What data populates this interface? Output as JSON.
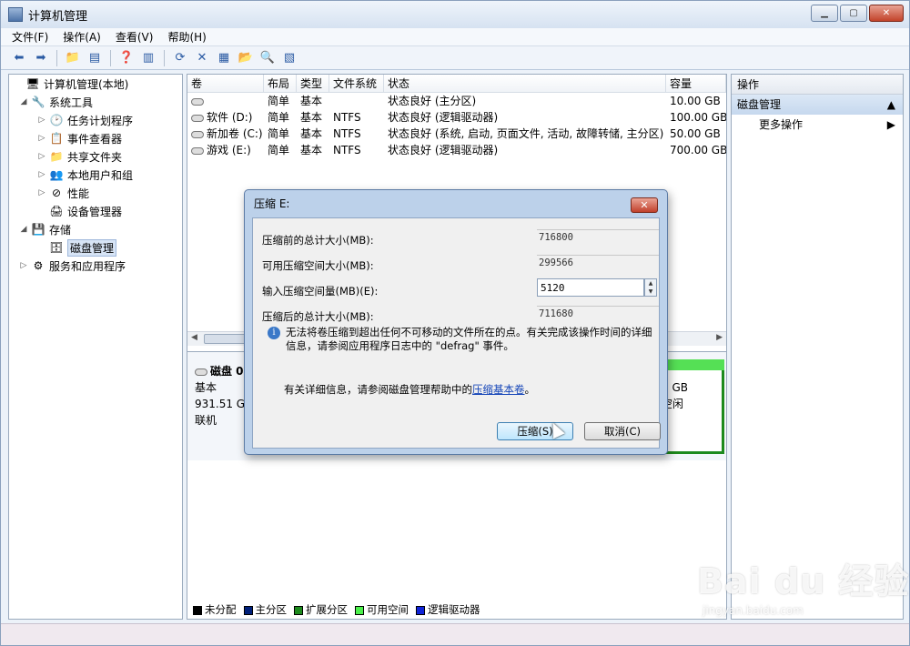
{
  "window": {
    "title": "计算机管理"
  },
  "menu": [
    "文件(F)",
    "操作(A)",
    "查看(V)",
    "帮助(H)"
  ],
  "tree": [
    {
      "label": "计算机管理(本地)",
      "level": 0,
      "exp": ""
    },
    {
      "label": "系统工具",
      "level": 1,
      "exp": "◢"
    },
    {
      "label": "任务计划程序",
      "level": 2,
      "exp": "▷"
    },
    {
      "label": "事件查看器",
      "level": 2,
      "exp": "▷"
    },
    {
      "label": "共享文件夹",
      "level": 2,
      "exp": "▷"
    },
    {
      "label": "本地用户和组",
      "level": 2,
      "exp": "▷"
    },
    {
      "label": "性能",
      "level": 2,
      "exp": "▷"
    },
    {
      "label": "设备管理器",
      "level": 2,
      "exp": ""
    },
    {
      "label": "存储",
      "level": 1,
      "exp": "◢"
    },
    {
      "label": "磁盘管理",
      "level": 2,
      "exp": ""
    },
    {
      "label": "服务和应用程序",
      "level": 1,
      "exp": "▷"
    }
  ],
  "volume_list": {
    "headers": [
      "卷",
      "布局",
      "类型",
      "文件系统",
      "状态",
      "容量"
    ],
    "rows": [
      [
        "",
        "简单",
        "基本",
        "",
        "状态良好 (主分区)",
        "10.00 GB"
      ],
      [
        "软件 (D:)",
        "简单",
        "基本",
        "NTFS",
        "状态良好 (逻辑驱动器)",
        "100.00 GB"
      ],
      [
        "新加卷 (C:)",
        "简单",
        "基本",
        "NTFS",
        "状态良好 (系统, 启动, 页面文件, 活动, 故障转储, 主分区)",
        "50.00 GB"
      ],
      [
        "游戏 (E:)",
        "简单",
        "基本",
        "NTFS",
        "状态良好 (逻辑驱动器)",
        "700.00 GB"
      ]
    ]
  },
  "disk": {
    "name": "磁盘 0",
    "type": "基本",
    "size": "931.51 GB",
    "state": "联机",
    "part_size": "0 GB",
    "part_state": "空闲"
  },
  "legend": [
    {
      "label": "未分配",
      "color": "#000000"
    },
    {
      "label": "主分区",
      "color": "#00207a"
    },
    {
      "label": "扩展分区",
      "color": "#1d8a1d"
    },
    {
      "label": "可用空间",
      "color": "#4cf04c"
    },
    {
      "label": "逻辑驱动器",
      "color": "#1024d8"
    }
  ],
  "actions": {
    "header": "操作",
    "section": "磁盘管理",
    "more": "更多操作"
  },
  "dialog": {
    "title": "压缩 E:",
    "fields": [
      {
        "label": "压缩前的总计大小(MB):",
        "value": "716800"
      },
      {
        "label": "可用压缩空间大小(MB):",
        "value": "299566"
      },
      {
        "label": "输入压缩空间量(MB)(E):",
        "value": "5120"
      },
      {
        "label": "压缩后的总计大小(MB):",
        "value": "711680"
      }
    ],
    "info": "无法将卷压缩到超出任何不可移动的文件所在的点。有关完成该操作时间的详细信息，请参阅应用程序日志中的 \"defrag\" 事件。",
    "help_prefix": "有关详细信息，请参阅磁盘管理帮助中的",
    "help_link": "压缩基本卷",
    "help_suffix": "。",
    "ok_label": "压缩(S)",
    "cancel_label": "取消(C)"
  },
  "watermark": {
    "brand": "Bai du 经验",
    "url": "jingyan.baidu.com"
  }
}
